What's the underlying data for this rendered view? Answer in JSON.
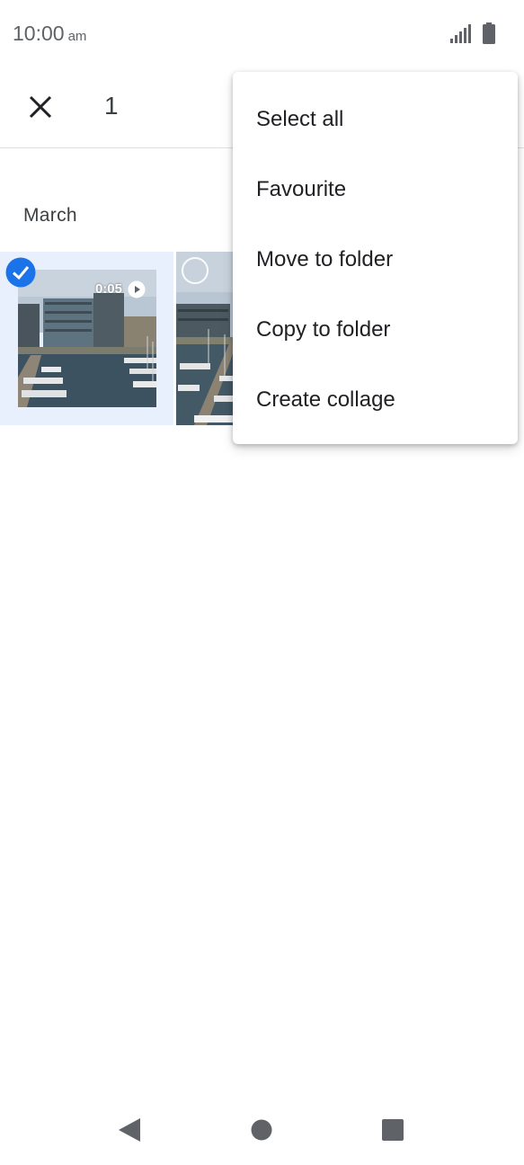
{
  "status_bar": {
    "time": "10:00",
    "ampm": "am",
    "icons": [
      "signal-icon",
      "battery-icon"
    ]
  },
  "app_bar": {
    "close_icon": "close-icon",
    "selected_count": "1"
  },
  "gallery": {
    "section_title": "March",
    "items": [
      {
        "type": "video",
        "duration": "0:05",
        "selected": true
      },
      {
        "type": "photo",
        "selected": false
      }
    ]
  },
  "menu": {
    "items": [
      {
        "label": "Select all"
      },
      {
        "label": "Favourite"
      },
      {
        "label": "Move to folder"
      },
      {
        "label": "Copy to folder"
      },
      {
        "label": "Create collage"
      }
    ]
  },
  "nav": {
    "icons": [
      "back-icon",
      "home-icon",
      "recents-icon"
    ]
  },
  "colors": {
    "accent": "#1a73e8",
    "selection_bg": "#e8f0fe"
  }
}
